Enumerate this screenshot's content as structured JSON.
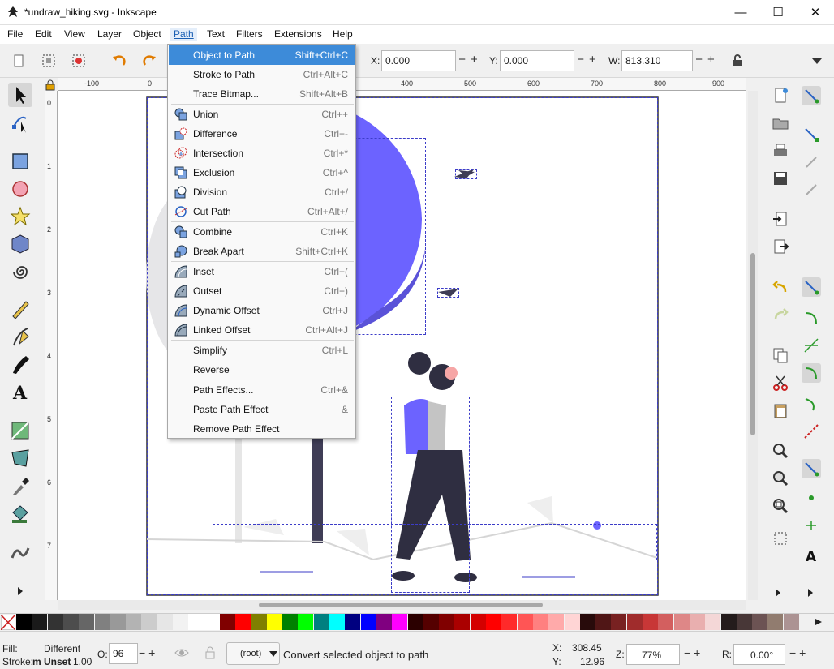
{
  "window": {
    "title": "*undraw_hiking.svg - Inkscape",
    "min": "—",
    "max": "☐",
    "close": "✕"
  },
  "menu": [
    "File",
    "Edit",
    "View",
    "Layer",
    "Object",
    "Path",
    "Text",
    "Filters",
    "Extensions",
    "Help"
  ],
  "toolbar": {
    "x_label": "X:",
    "x_value": "0.000",
    "y_label": "Y:",
    "y_value": "0.000",
    "w_label": "W:",
    "w_value": "813.310",
    "spin": "−+"
  },
  "ruler_h": [
    "-100",
    "0",
    "400",
    "500",
    "600",
    "700",
    "800",
    "900"
  ],
  "ruler_v": [
    "0",
    "1",
    "2",
    "3",
    "4",
    "5",
    "6",
    "7"
  ],
  "path_menu": [
    {
      "label": "Object to Path",
      "shortcut": "Shift+Ctrl+C",
      "icon": "none",
      "highlight": true
    },
    {
      "label": "Stroke to Path",
      "shortcut": "Ctrl+Alt+C",
      "icon": "none"
    },
    {
      "label": "Trace Bitmap...",
      "shortcut": "Shift+Alt+B",
      "icon": "none"
    },
    {
      "label": "Union",
      "shortcut": "Ctrl++",
      "icon": "union-icon"
    },
    {
      "label": "Difference",
      "shortcut": "Ctrl+-",
      "icon": "difference-icon"
    },
    {
      "label": "Intersection",
      "shortcut": "Ctrl+*",
      "icon": "intersection-icon"
    },
    {
      "label": "Exclusion",
      "shortcut": "Ctrl+^",
      "icon": "exclusion-icon"
    },
    {
      "label": "Division",
      "shortcut": "Ctrl+/",
      "icon": "division-icon"
    },
    {
      "label": "Cut Path",
      "shortcut": "Ctrl+Alt+/",
      "icon": "cut-path-icon"
    },
    {
      "label": "Combine",
      "shortcut": "Ctrl+K",
      "icon": "combine-icon"
    },
    {
      "label": "Break Apart",
      "shortcut": "Shift+Ctrl+K",
      "icon": "break-apart-icon"
    },
    {
      "label": "Inset",
      "shortcut": "Ctrl+(",
      "icon": "inset-icon"
    },
    {
      "label": "Outset",
      "shortcut": "Ctrl+)",
      "icon": "outset-icon"
    },
    {
      "label": "Dynamic Offset",
      "shortcut": "Ctrl+J",
      "icon": "dynamic-offset-icon"
    },
    {
      "label": "Linked Offset",
      "shortcut": "Ctrl+Alt+J",
      "icon": "linked-offset-icon"
    },
    {
      "label": "Simplify",
      "shortcut": "Ctrl+L",
      "icon": "none"
    },
    {
      "label": "Reverse",
      "shortcut": "",
      "icon": "none"
    },
    {
      "label": "Path Effects...",
      "shortcut": "Ctrl+&",
      "icon": "none"
    },
    {
      "label": "Paste Path Effect",
      "shortcut": "&",
      "icon": "none"
    },
    {
      "label": "Remove Path Effect",
      "shortcut": "",
      "icon": "none"
    }
  ],
  "status": {
    "fill_label": "Fill:",
    "fill_value": "Different",
    "stroke_label": "Stroke:",
    "stroke_value": "m Unset",
    "stroke_width": "1.00",
    "opacity_label": "O:",
    "opacity_value": "96",
    "layer": "(root)",
    "message": "Convert selected object to path",
    "x_label": "X:",
    "x_value": "308.45",
    "y_label": "Y:",
    "y_value": "12.96",
    "zoom_label": "Z:",
    "zoom_value": "77%",
    "rot_label": "R:",
    "rot_value": "0.00°"
  },
  "palette": [
    "#000000",
    "#1a1a1a",
    "#333333",
    "#4d4d4d",
    "#666666",
    "#808080",
    "#999999",
    "#b3b3b3",
    "#cccccc",
    "#e6e6e6",
    "#f2f2f2",
    "#ffffff",
    "#ffffff",
    "#800000",
    "#ff0000",
    "#808000",
    "#ffff00",
    "#008000",
    "#00ff00",
    "#008080",
    "#00ffff",
    "#000080",
    "#0000ff",
    "#800080",
    "#ff00ff",
    "#2b0000",
    "#550000",
    "#800000",
    "#aa0000",
    "#d40000",
    "#ff0000",
    "#ff2a2a",
    "#ff5555",
    "#ff8080",
    "#ffaaaa",
    "#ffd5d5",
    "#280b0b",
    "#501616",
    "#782121",
    "#a02c2c",
    "#c83737",
    "#d35f5f",
    "#de8787",
    "#e9afaf",
    "#f4d7d7",
    "#241c1c",
    "#483737",
    "#6c5353",
    "#917c6f",
    "#ac9393"
  ],
  "accent": "#3d8bd9",
  "art_blue": "#6c63ff"
}
